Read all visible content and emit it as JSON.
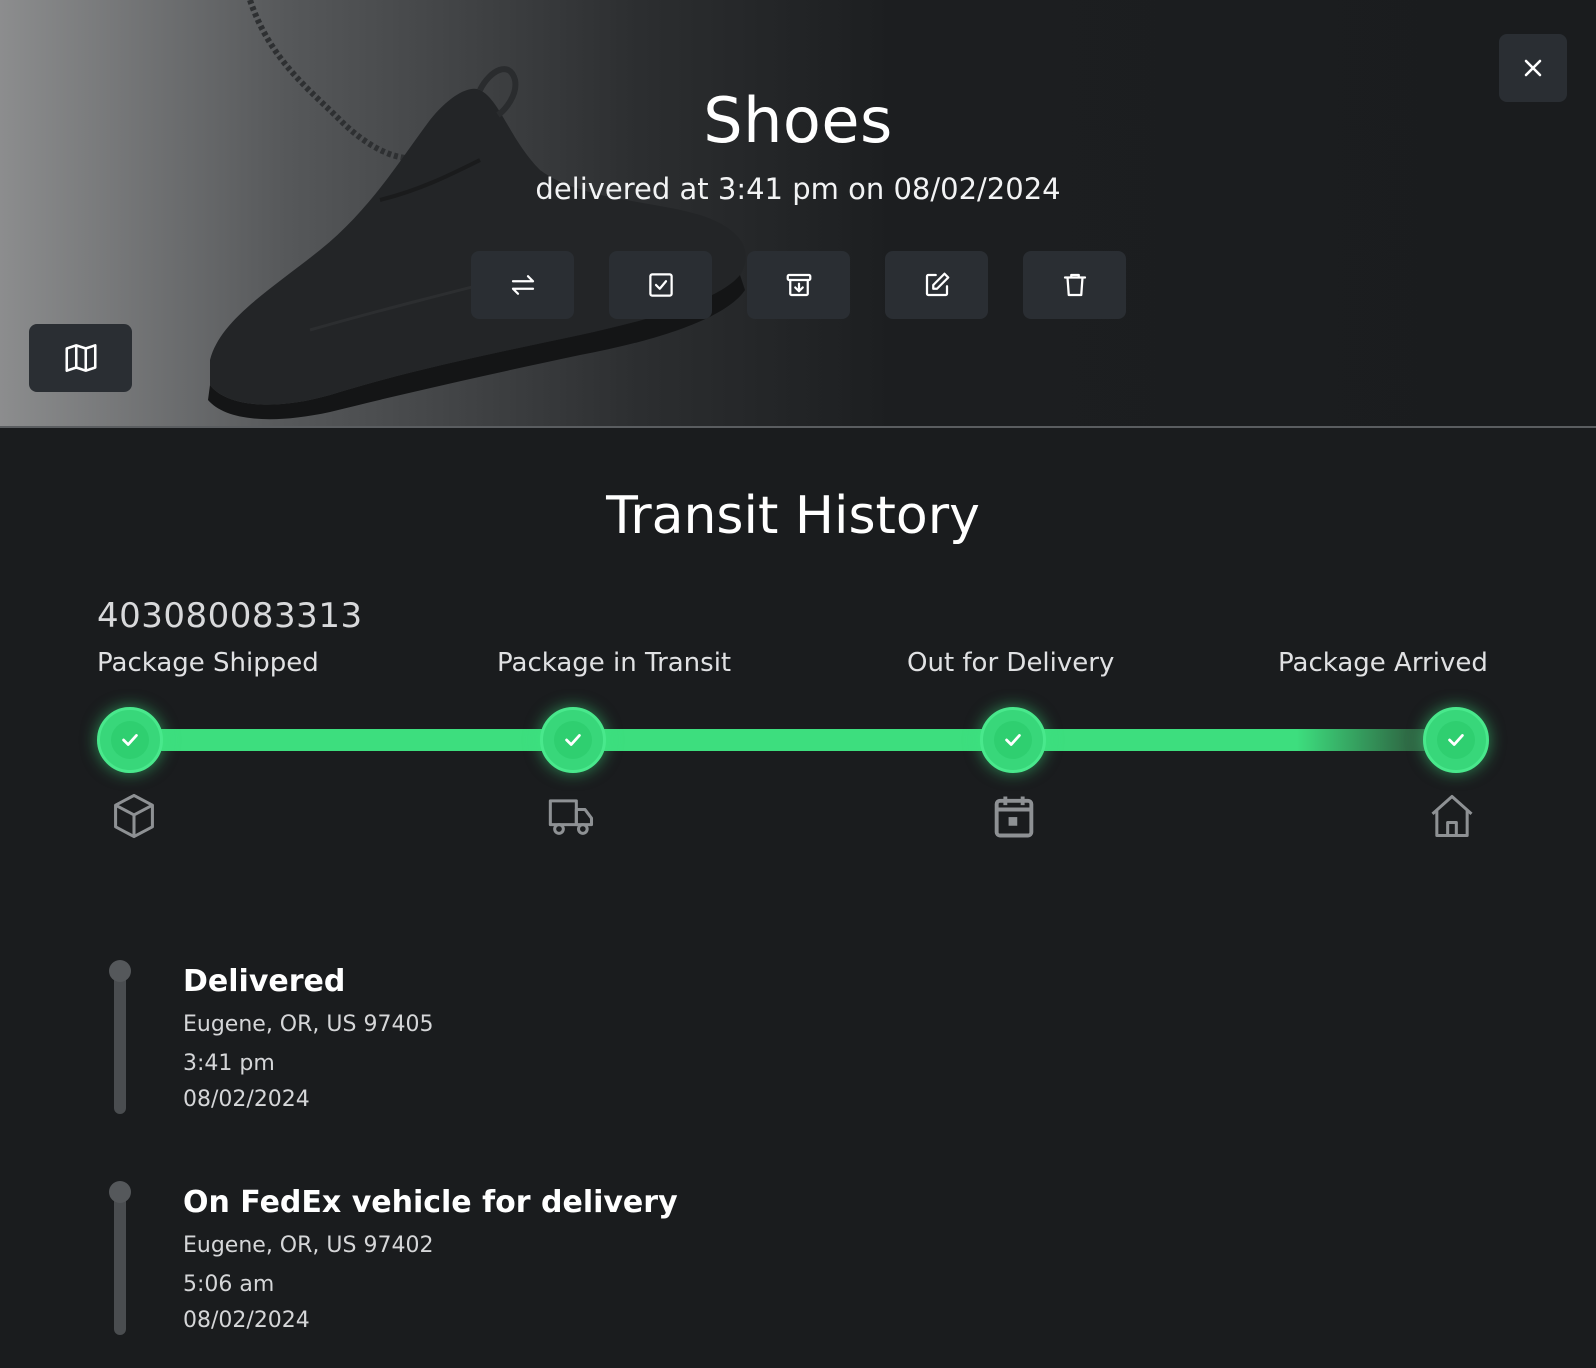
{
  "header": {
    "title": "Shoes",
    "subtitle": "delivered at 3:41 pm on 08/02/2024",
    "actions": [
      {
        "icon": "swap-arrows-icon"
      },
      {
        "icon": "checkbox-icon"
      },
      {
        "icon": "archive-icon"
      },
      {
        "icon": "edit-icon"
      },
      {
        "icon": "trash-icon"
      }
    ],
    "map_icon": "map-icon",
    "close_icon": "close-icon"
  },
  "transit": {
    "title": "Transit History",
    "tracking_number": "403080083313",
    "steps": [
      {
        "label": "Package Shipped",
        "icon": "box-icon",
        "completed": true
      },
      {
        "label": "Package in Transit",
        "icon": "truck-icon",
        "completed": true
      },
      {
        "label": "Out for Delivery",
        "icon": "calendar-icon",
        "completed": true
      },
      {
        "label": "Package Arrived",
        "icon": "home-icon",
        "completed": true
      }
    ]
  },
  "events": [
    {
      "status": "Delivered",
      "location": "Eugene, OR, US 97405",
      "time": "3:41 pm",
      "date": "08/02/2024"
    },
    {
      "status": "On FedEx vehicle for delivery",
      "location": "Eugene, OR, US 97402",
      "time": "5:06 am",
      "date": "08/02/2024"
    }
  ],
  "colors": {
    "accent_green": "#3dde7e",
    "background": "#1a1c1e",
    "button_bg": "#2a2e33"
  }
}
